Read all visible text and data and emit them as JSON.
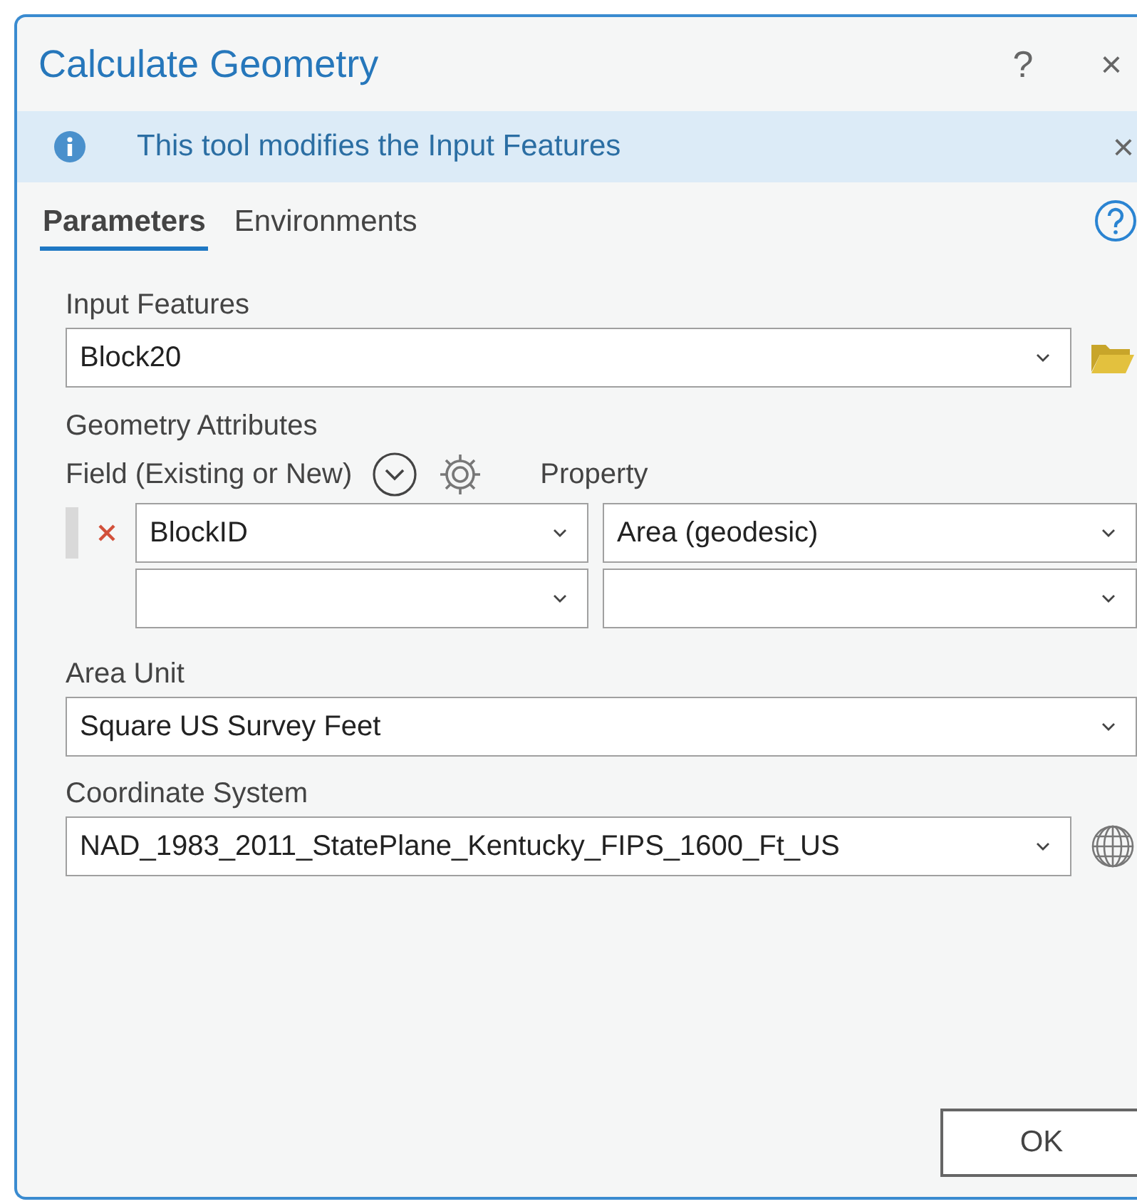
{
  "dialog": {
    "title": "Calculate Geometry",
    "help_button": "?",
    "close_button": "×"
  },
  "info_bar": {
    "message": "This tool modifies the Input Features",
    "dismiss_button": "×"
  },
  "tabs": [
    {
      "label": "Parameters",
      "selected": true
    },
    {
      "label": "Environments",
      "selected": false
    }
  ],
  "input_features": {
    "label": "Input Features",
    "value": "Block20"
  },
  "geometry_attributes": {
    "label": "Geometry Attributes",
    "field_label": "Field (Existing or New)",
    "property_label": "Property",
    "rows": [
      {
        "removable": true,
        "field": "BlockID",
        "property": "Area (geodesic)"
      },
      {
        "removable": false
      }
    ]
  },
  "area_unit": {
    "label": "Area Unit",
    "value": "Square US Survey Feet"
  },
  "coordinate_system": {
    "label": "Coordinate System",
    "value": "NAD_1983_2011_StatePlane_Kentucky_FIPS_1600_Ft_US"
  },
  "ok_button": "OK"
}
